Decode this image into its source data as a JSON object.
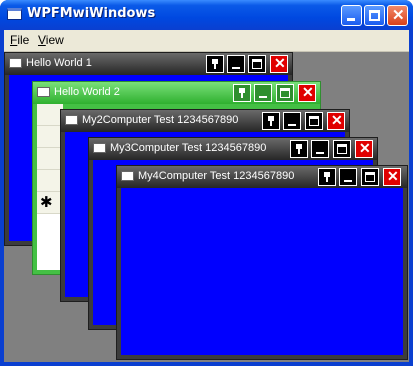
{
  "window": {
    "title": "WPFMwiWindows",
    "accent": "#0a3fd0"
  },
  "menu": [
    {
      "label": "File"
    },
    {
      "label": "View"
    }
  ],
  "children": [
    {
      "title": "Hello World 1",
      "theme": "dark"
    },
    {
      "title": "Hello World 2",
      "theme": "green"
    },
    {
      "title": "My2Computer Test 1234567890",
      "theme": "dark"
    },
    {
      "title": "My3Computer Test 1234567890",
      "theme": "dark"
    },
    {
      "title": "My4Computer Test 1234567890",
      "theme": "dark"
    }
  ],
  "grid": {
    "new_row_marker": "✱"
  },
  "colors": {
    "content": "#0000ff",
    "active_child": "#44c044",
    "inactive_child": "#3c3c3c",
    "client_bg": "#808080"
  }
}
